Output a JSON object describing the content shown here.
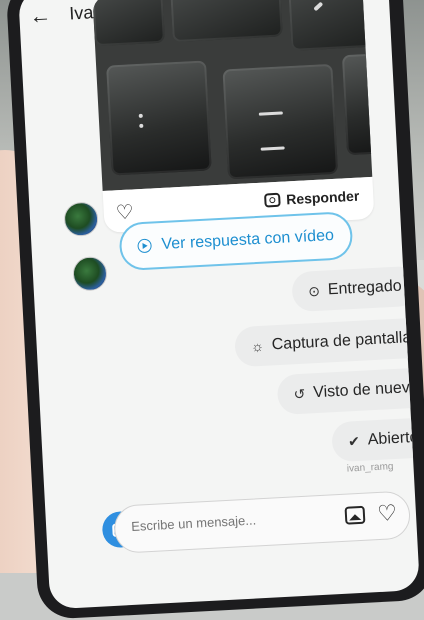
{
  "header": {
    "title": "Ivan_"
  },
  "post": {
    "reply_label": "Responder"
  },
  "messages": {
    "video_reply_label": "Ver respuesta con vídeo",
    "status_items": [
      {
        "icon": "circle-dot-icon",
        "label": "Entregado"
      },
      {
        "icon": "sparkle-icon",
        "label": "Captura de pantalla"
      },
      {
        "icon": "replay-icon",
        "label": "Visto de nuevo"
      },
      {
        "icon": "check-circle-icon",
        "label": "Abierto"
      }
    ],
    "seen_by": "ivan_ramg"
  },
  "composer": {
    "placeholder": "Escribe un mensaje..."
  }
}
